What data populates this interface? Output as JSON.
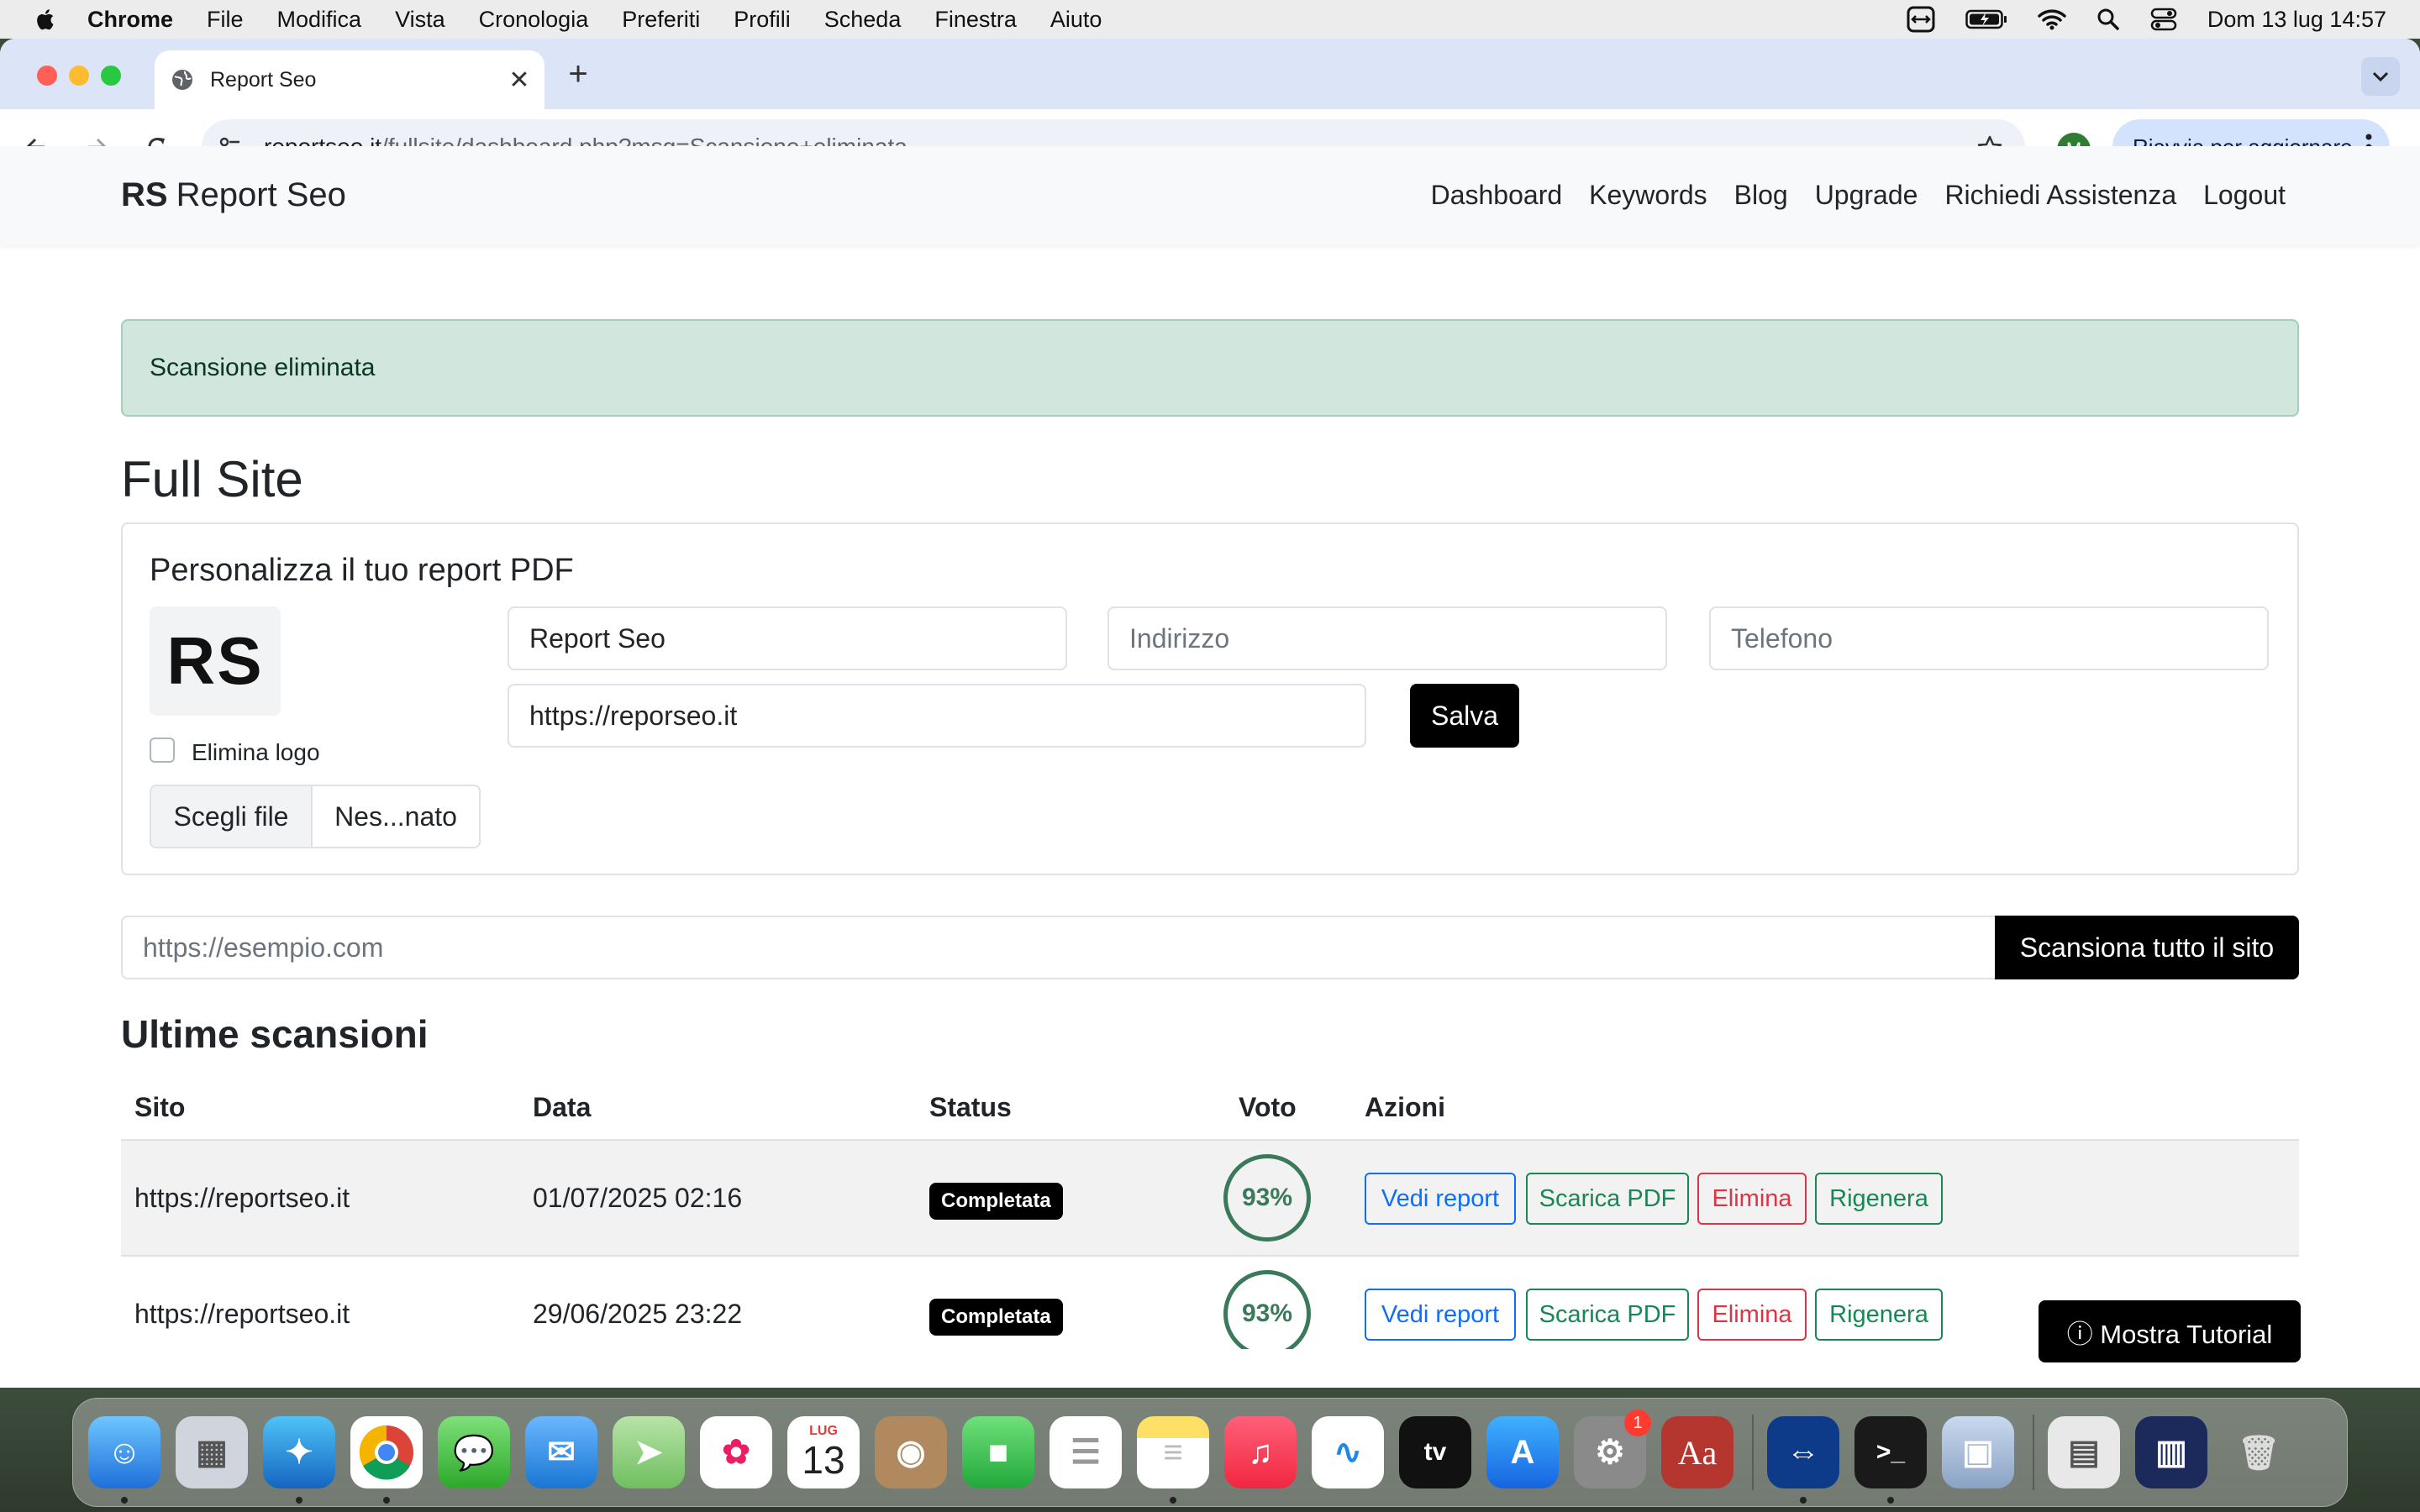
{
  "menubar": {
    "app": "Chrome",
    "items": [
      "File",
      "Modifica",
      "Vista",
      "Cronologia",
      "Preferiti",
      "Profili",
      "Scheda",
      "Finestra",
      "Aiuto"
    ],
    "clock": "Dom 13 lug  14:57"
  },
  "browser": {
    "tab_title": "Report Seo",
    "url_host": "reportseo.it",
    "url_path": "/fullsite/dashboard.php?msg=Scansione+eliminata",
    "profile_initial": "M",
    "update_label": "Riavvia per aggiornare"
  },
  "site": {
    "brand_short": "RS",
    "brand_name": "Report Seo",
    "nav": [
      "Dashboard",
      "Keywords",
      "Blog",
      "Upgrade",
      "Richiedi Assistenza",
      "Logout"
    ]
  },
  "alert": "Scansione eliminata",
  "page_title": "Full Site",
  "pdf_card": {
    "title": "Personalizza il tuo report PDF",
    "logo_text": "RS",
    "delete_logo_label": "Elimina logo",
    "choose_file": "Scegli file",
    "no_file": "Nes...nato",
    "name_value": "Report Seo",
    "address_placeholder": "Indirizzo",
    "phone_placeholder": "Telefono",
    "website_value": "https://reporseo.it",
    "save_label": "Salva"
  },
  "scan": {
    "placeholder": "https://esempio.com",
    "button": "Scansiona tutto il sito"
  },
  "scans": {
    "heading": "Ultime scansioni",
    "columns": [
      "Sito",
      "Data",
      "Status",
      "Voto",
      "Azioni"
    ],
    "rows": [
      {
        "site": "https://reportseo.it",
        "date": "01/07/2025 02:16",
        "status": "Completata",
        "score": "93%"
      },
      {
        "site": "https://reportseo.it",
        "date": "29/06/2025 23:22",
        "status": "Completata",
        "score": "93%"
      }
    ],
    "actions": {
      "view": "Vedi report",
      "pdf": "Scarica PDF",
      "delete": "Elimina",
      "regen": "Rigenera"
    }
  },
  "tutorial_button": "ⓘ Mostra Tutorial",
  "dock": {
    "calendar_month": "LUG",
    "calendar_day": "13",
    "settings_badge": "1"
  },
  "colors": {
    "alert_bg": "#d1e7dd",
    "score_ring": "#3a7a5b",
    "primary": "#0d6efd",
    "success": "#198754",
    "danger": "#dc3545"
  }
}
